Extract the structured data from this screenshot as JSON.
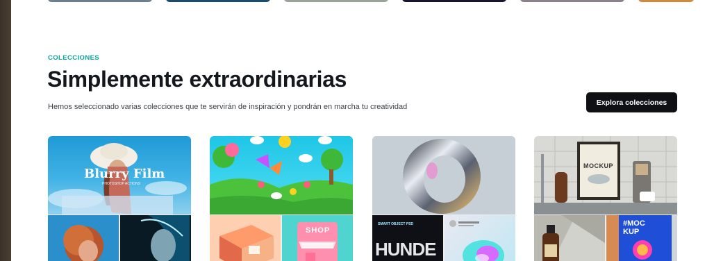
{
  "section": {
    "eyebrow": "COLECCIONES",
    "title": "Simplemente extraordinarias",
    "description": "Hemos seleccionado varias colecciones que te servirán de inspiración y pondrán en marcha tu creatividad",
    "cta_label": "Explora colecciones"
  },
  "cards": [
    {
      "name": "blurry-film",
      "overlay_title": "Blurry Film",
      "overlay_sub": "PHOTOSHOP ACTIONS"
    },
    {
      "name": "3d-illustrations",
      "sign_text": "SHOP"
    },
    {
      "name": "smart-object",
      "label_top": "SMART OBJECT PSD",
      "label_word": "HUNDE"
    },
    {
      "name": "mockups",
      "frame_text": "MOCKUP",
      "poster_text": "#MOC\nKUP"
    }
  ],
  "colors": {
    "eyebrow": "#0aa5a0",
    "title": "#14171c",
    "cta_bg": "#0e1014",
    "cta_text": "#ffffff"
  }
}
